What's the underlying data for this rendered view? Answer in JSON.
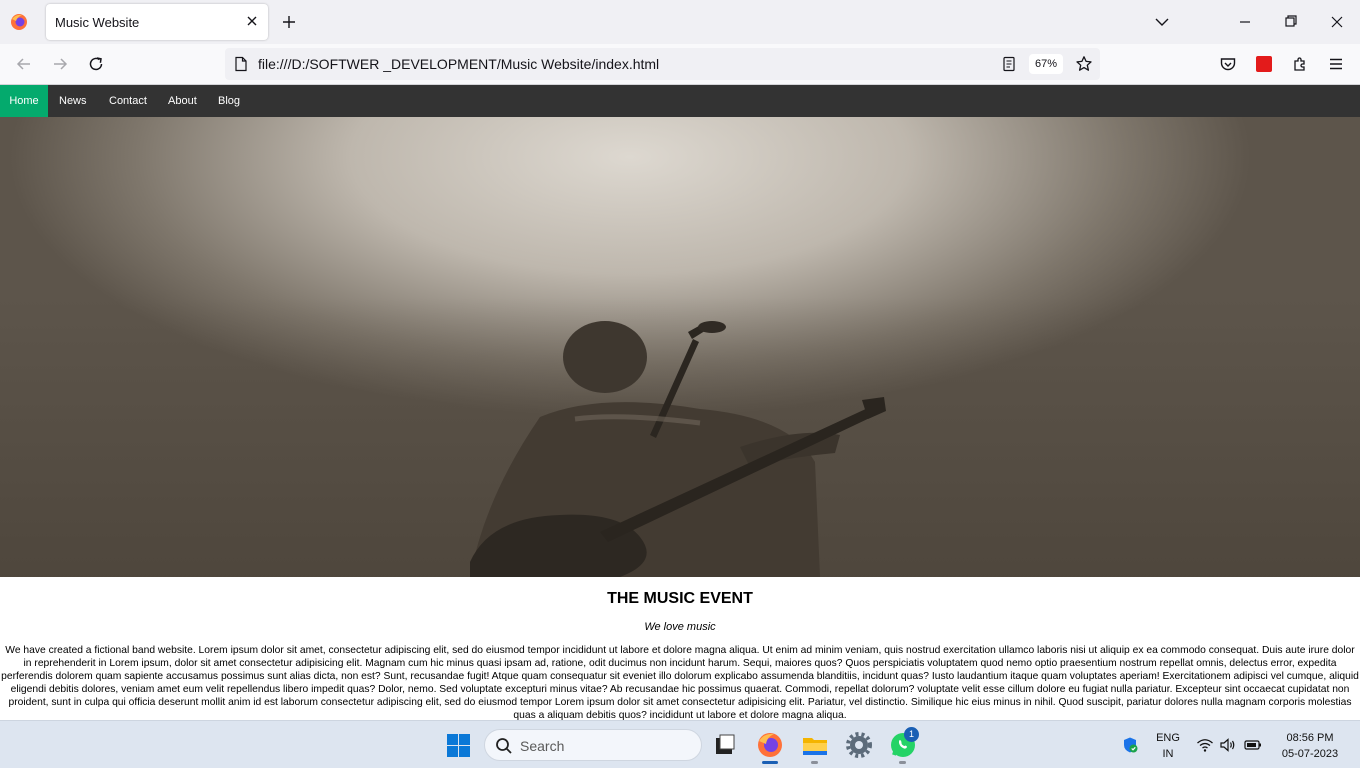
{
  "browser": {
    "tab_title": "Music Website",
    "url": "file:///D:/SOFTWER _DEVELOPMENT/Music Website/index.html",
    "zoom": "67%"
  },
  "site": {
    "nav_items": [
      "Home",
      "News",
      "Contact",
      "About",
      "Blog"
    ],
    "active_nav": "Home",
    "title": "THE MUSIC EVENT",
    "tagline": "We love music",
    "body": "We have created a fictional band website. Lorem ipsum dolor sit amet, consectetur adipiscing elit, sed do eiusmod tempor incididunt ut labore et dolore magna aliqua. Ut enim ad minim veniam, quis nostrud exercitation ullamco laboris nisi ut aliquip ex ea commodo consequat. Duis aute irure dolor in reprehenderit in Lorem ipsum, dolor sit amet consectetur adipisicing elit. Magnam cum hic minus quasi ipsam ad, ratione, odit ducimus non incidunt harum. Sequi, maiores quos? Quos perspiciatis voluptatem quod nemo optio praesentium nostrum repellat omnis, delectus error, expedita perferendis dolorem quam sapiente accusamus possimus sunt alias dicta, non est? Sunt, recusandae fugit! Atque quam consequatur sit eveniet illo dolorum explicabo assumenda blanditiis, incidunt quas? Iusto laudantium itaque quam voluptates aperiam! Exercitationem adipisci vel cumque, aliquid eligendi debitis dolores, veniam amet eum velit repellendus libero impedit quas? Dolor, nemo. Sed voluptate excepturi minus vitae? Ab recusandae hic possimus quaerat. Commodi, repellat dolorum? voluptate velit esse cillum dolore eu fugiat nulla pariatur. Excepteur sint occaecat cupidatat non proident, sunt in culpa qui officia deserunt mollit anim id est laborum consectetur adipiscing elit, sed do eiusmod tempor Lorem ipsum dolor sit amet consectetur adipisicing elit. Pariatur, vel distinctio. Similique hic eius minus in nihil. Quod suscipit, pariatur dolores nulla magnam corporis molestias quas a aliquam debitis quos? incididunt ut labore et dolore magna aliqua.",
    "accent_color": "#04aa6d"
  },
  "taskbar": {
    "search_placeholder": "Search",
    "whatsapp_badge": "1",
    "lang_line1": "ENG",
    "lang_line2": "IN",
    "time": "08:56 PM",
    "date": "05-07-2023"
  }
}
